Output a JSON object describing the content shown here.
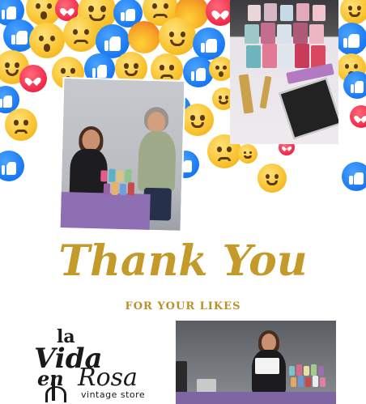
{
  "heading": {
    "title": "Thank You",
    "subtitle": "FOR YOUR LIKES"
  },
  "logo": {
    "line1": "la",
    "line2": "Vida",
    "line3": "en",
    "line4": "Rosa",
    "tagline": "vintage store"
  },
  "colors": {
    "heading_gold": "#c49a2a",
    "like_blue": "#1877f2",
    "heart_red": "#f0284a",
    "emoji_yellow": "#f9c22e"
  },
  "photos": [
    {
      "name": "two-women-with-paint-display"
    },
    {
      "name": "paint-jars-and-brushes"
    },
    {
      "name": "woman-at-vendor-table"
    }
  ]
}
